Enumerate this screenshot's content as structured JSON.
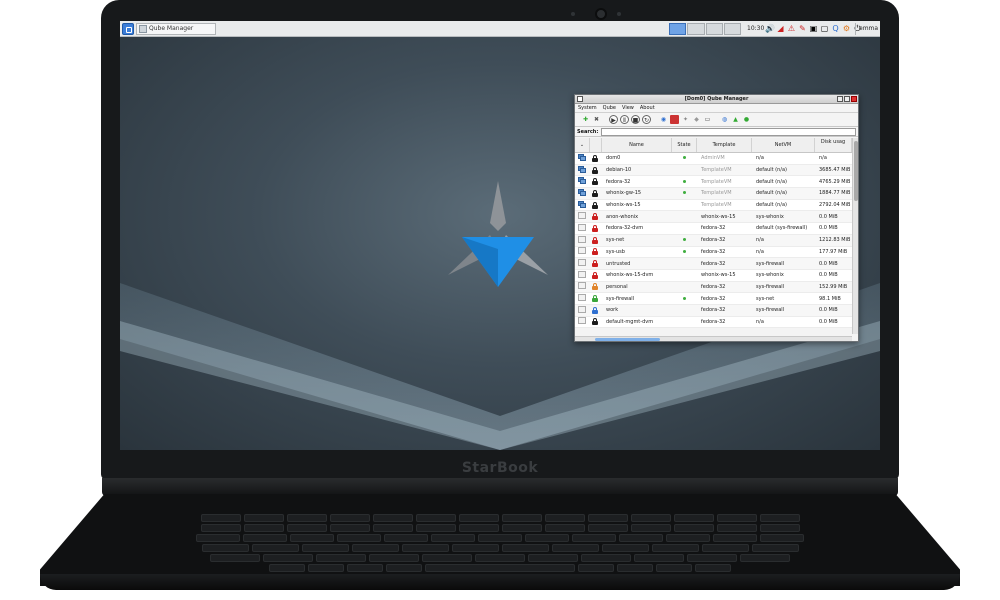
{
  "device": {
    "brand": "StarBook"
  },
  "panel": {
    "task_label": "Qube Manager",
    "clock": "10:30",
    "user": "emma"
  },
  "window": {
    "title": "[Dom0] Qube Manager",
    "menus": [
      "System",
      "Qube",
      "View",
      "About"
    ],
    "search_label": "Search:",
    "search_value": "",
    "columns": [
      "",
      "",
      "Name",
      "State",
      "Template",
      "NetVM",
      "Disk usag"
    ],
    "rows": [
      {
        "name": "dom0",
        "state": "running",
        "template": "AdminVM",
        "netvm": "n/a",
        "disk": "n/a",
        "type": "admin",
        "label": "black"
      },
      {
        "name": "debian-10",
        "state": "",
        "template": "TemplateVM",
        "netvm": "default (n/a)",
        "disk": "3685.47 MiB",
        "type": "template",
        "label": "black"
      },
      {
        "name": "fedora-32",
        "state": "running",
        "template": "TemplateVM",
        "netvm": "default (n/a)",
        "disk": "4765.29 MiB",
        "type": "template",
        "label": "black"
      },
      {
        "name": "whonix-gw-15",
        "state": "running",
        "template": "TemplateVM",
        "netvm": "default (n/a)",
        "disk": "1884.77 MiB",
        "type": "template",
        "label": "black"
      },
      {
        "name": "whonix-ws-15",
        "state": "",
        "template": "TemplateVM",
        "netvm": "default (n/a)",
        "disk": "2792.04 MiB",
        "type": "template",
        "label": "black"
      },
      {
        "name": "anon-whonix",
        "state": "",
        "template": "whonix-ws-15",
        "netvm": "sys-whonix",
        "disk": "0.0 MiB",
        "type": "app",
        "label": "red"
      },
      {
        "name": "fedora-32-dvm",
        "state": "",
        "template": "fedora-32",
        "netvm": "default (sys-firewall)",
        "disk": "0.0 MiB",
        "type": "app",
        "label": "red"
      },
      {
        "name": "sys-net",
        "state": "running",
        "template": "fedora-32",
        "netvm": "n/a",
        "disk": "1212.83 MiB",
        "type": "app",
        "label": "red"
      },
      {
        "name": "sys-usb",
        "state": "running",
        "template": "fedora-32",
        "netvm": "n/a",
        "disk": "177.97 MiB",
        "type": "app",
        "label": "red"
      },
      {
        "name": "untrusted",
        "state": "",
        "template": "fedora-32",
        "netvm": "sys-firewall",
        "disk": "0.0 MiB",
        "type": "app",
        "label": "red"
      },
      {
        "name": "whonix-ws-15-dvm",
        "state": "",
        "template": "whonix-ws-15",
        "netvm": "sys-whonix",
        "disk": "0.0 MiB",
        "type": "app",
        "label": "red"
      },
      {
        "name": "personal",
        "state": "",
        "template": "fedora-32",
        "netvm": "sys-firewall",
        "disk": "152.99 MiB",
        "type": "app",
        "label": "orange"
      },
      {
        "name": "sys-firewall",
        "state": "running",
        "template": "fedora-32",
        "netvm": "sys-net",
        "disk": "98.1 MiB",
        "type": "app",
        "label": "green"
      },
      {
        "name": "work",
        "state": "",
        "template": "fedora-32",
        "netvm": "sys-firewall",
        "disk": "0.0 MiB",
        "type": "app",
        "label": "blue"
      },
      {
        "name": "default-mgmt-dvm",
        "state": "",
        "template": "fedora-32",
        "netvm": "n/a",
        "disk": "0.0 MiB",
        "type": "app",
        "label": "black"
      }
    ]
  },
  "colors": {
    "label_black": "#1c1c1c",
    "label_red": "#cc1f1f",
    "label_orange": "#e0842a",
    "label_green": "#3aa63a",
    "label_blue": "#2f6fd0",
    "running": "#3fae3f",
    "logo_blue": "#1f8fe6"
  }
}
